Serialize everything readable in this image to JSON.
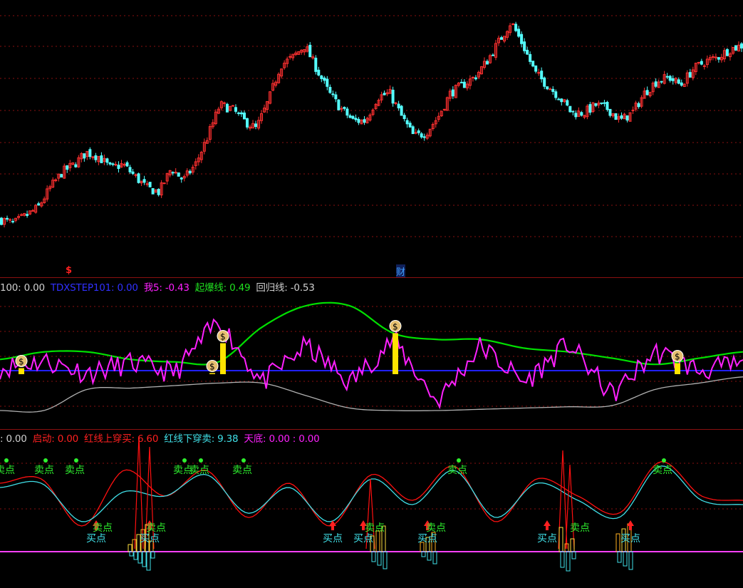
{
  "colors": {
    "background": "#000000",
    "up": "#ff3030",
    "down": "#54ffff",
    "grid": "#8a1010",
    "green_line": "#00e000",
    "blue_line": "#2020ff",
    "magenta_line": "#ff20ff",
    "gray_line": "#b0b0b0",
    "yellow_bar": "#ffe400",
    "red_line": "#ff1010",
    "cyan_line": "#40e0e8",
    "buy_label": "#40e0e8",
    "sell_label": "#2ef02e"
  },
  "price_panel": {
    "marker_dollar": "$",
    "marker_cai": "财"
  },
  "mid_panel": {
    "legend": [
      {
        "text": "100: 0.00",
        "color": "#d0d0d0"
      },
      {
        "text": "TDXSTEP101: 0.00",
        "color": "#3030ff"
      },
      {
        "text": "我5: -0.43",
        "color": "#ff20ff"
      },
      {
        "text": "起爆线: 0.49",
        "color": "#20e020"
      },
      {
        "text": "回归线: -0.53",
        "color": "#d0d0d0"
      }
    ]
  },
  "low_panel": {
    "legend": [
      {
        "text": ": 0.00",
        "color": "#d0d0d0"
      },
      {
        "text": "启动: 0.00",
        "color": "#ff2020"
      },
      {
        "text": "红线上穿买: 6.60",
        "color": "#ff2020"
      },
      {
        "text": "红线下穿卖: 9.38",
        "color": "#40e0e8"
      },
      {
        "text": "天底: 0.00 : 0.00",
        "color": "#ff20ff"
      }
    ],
    "buy_label": "买点",
    "sell_label": "卖点"
  },
  "chart_data": [
    {
      "type": "candlestick",
      "y_relative_levels": [
        0.15,
        0.1,
        0.2,
        0.3,
        0.55,
        0.75,
        0.85,
        1.0,
        0.95,
        0.8,
        0.85,
        0.7,
        0.55,
        0.5,
        0.8,
        0.65,
        0.85,
        1.2,
        1.6,
        1.55,
        1.4,
        1.3,
        1.65,
        2.1,
        2.2,
        2.35,
        2.05,
        1.75,
        1.55,
        1.4,
        1.4,
        1.7,
        1.75,
        1.45,
        1.2,
        1.25,
        1.45,
        1.75,
        1.85,
        1.95,
        2.15,
        2.4,
        2.65,
        2.35,
        2.0,
        1.85,
        1.7,
        1.5,
        1.5,
        1.6,
        1.55,
        1.4,
        1.5,
        1.75,
        1.9,
        1.95,
        1.85,
        2.05,
        2.15,
        2.2,
        2.3,
        2.35
      ]
    },
    {
      "type": "line",
      "series": [
        {
          "name": "起爆线",
          "values": [
            0.49,
            0.55,
            0.55,
            0.49,
            0.47,
            0.47,
            0.75,
            0.92,
            0.92,
            0.7,
            0.65,
            0.65,
            0.58,
            0.55,
            0.5,
            0.45,
            0.5,
            0.55
          ]
        },
        {
          "name": "TDXSTEP101",
          "values": [
            0.4,
            0.4,
            0.4,
            0.4,
            0.4,
            0.4,
            0.4,
            0.4,
            0.4,
            0.4,
            0.4,
            0.4,
            0.4,
            0.4,
            0.4,
            0.4,
            0.4,
            0.4
          ]
        },
        {
          "name": "回归线",
          "values": [
            0.08,
            0.08,
            0.25,
            0.26,
            0.28,
            0.3,
            0.3,
            0.2,
            0.1,
            0.08,
            0.08,
            0.09,
            0.1,
            0.11,
            0.12,
            0.25,
            0.3,
            0.35
          ]
        },
        {
          "name": "我5",
          "values": [
            0.42,
            0.48,
            0.38,
            0.46,
            0.38,
            0.8,
            0.3,
            0.6,
            0.3,
            0.65,
            0.15,
            0.6,
            0.3,
            0.62,
            0.2,
            0.55,
            0.4,
            0.45
          ]
        }
      ]
    },
    {
      "type": "line",
      "series": [
        {
          "name": "红线上穿买",
          "values": [
            0.7,
            0.75,
            0.2,
            0.85,
            0.55,
            0.85,
            0.3,
            0.7,
            0.2,
            0.8,
            0.5,
            0.9,
            0.25,
            0.75,
            0.55,
            0.35,
            0.95,
            0.55,
            0.5
          ]
        },
        {
          "name": "红线下穿卖",
          "values": [
            0.65,
            0.7,
            0.25,
            0.6,
            0.55,
            0.8,
            0.35,
            0.65,
            0.25,
            0.75,
            0.45,
            0.85,
            0.3,
            0.7,
            0.5,
            0.3,
            0.9,
            0.5,
            0.45
          ]
        }
      ]
    }
  ]
}
